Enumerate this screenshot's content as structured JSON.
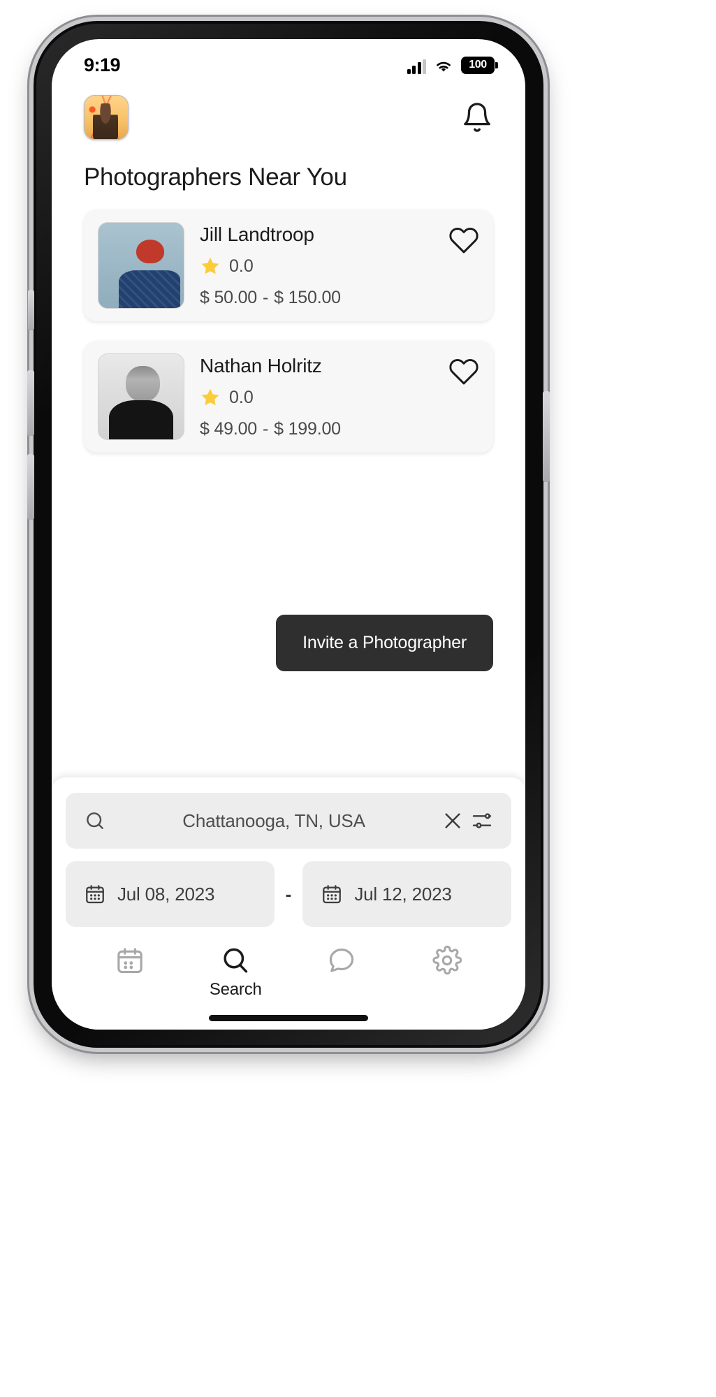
{
  "status_bar": {
    "time": "9:19",
    "battery_level": "100",
    "cellular_icon": "cellular-signal-icon",
    "wifi_icon": "wifi-icon",
    "battery_icon": "battery-icon"
  },
  "header": {
    "avatar_name": "user-avatar",
    "notification_icon": "bell-icon"
  },
  "page_title": "Photographers Near You",
  "cards": [
    {
      "name": "Jill Landtroop",
      "rating": "0.0",
      "star_icon": "star-icon",
      "price_min": "$ 50.00",
      "price_sep": "-",
      "price_max": "$ 150.00",
      "favorite_icon": "heart-outline-icon",
      "thumb_class": "thumb-jill"
    },
    {
      "name": "Nathan Holritz",
      "rating": "0.0",
      "star_icon": "star-icon",
      "price_min": "$ 49.00",
      "price_sep": "-",
      "price_max": "$ 199.00",
      "favorite_icon": "heart-outline-icon",
      "thumb_class": "thumb-nathan"
    }
  ],
  "invite_button": {
    "label": "Invite a Photographer",
    "background": "#2f2f2f",
    "text_color": "#ffffff"
  },
  "search": {
    "value": "Chattanooga, TN, USA",
    "placeholder": "Search location",
    "search_icon": "search-icon",
    "clear_icon": "close-x-icon",
    "filter_icon": "filter-sliders-icon"
  },
  "dates": {
    "start": "Jul 08, 2023",
    "end": "Jul 12, 2023",
    "separator": "-",
    "calendar_icon": "calendar-icon"
  },
  "tabs": [
    {
      "label": "",
      "icon": "calendar-icon",
      "active": false
    },
    {
      "label": "Search",
      "icon": "search-icon",
      "active": true
    },
    {
      "label": "",
      "icon": "chat-bubble-icon",
      "active": false
    },
    {
      "label": "",
      "icon": "gear-icon",
      "active": false
    }
  ],
  "colors": {
    "star_yellow": "#FBCC3A",
    "card_bg": "#f7f7f7",
    "field_bg": "#ededed",
    "accent_dark": "#2f2f2f",
    "inactive_gray": "#9a9a9a"
  }
}
